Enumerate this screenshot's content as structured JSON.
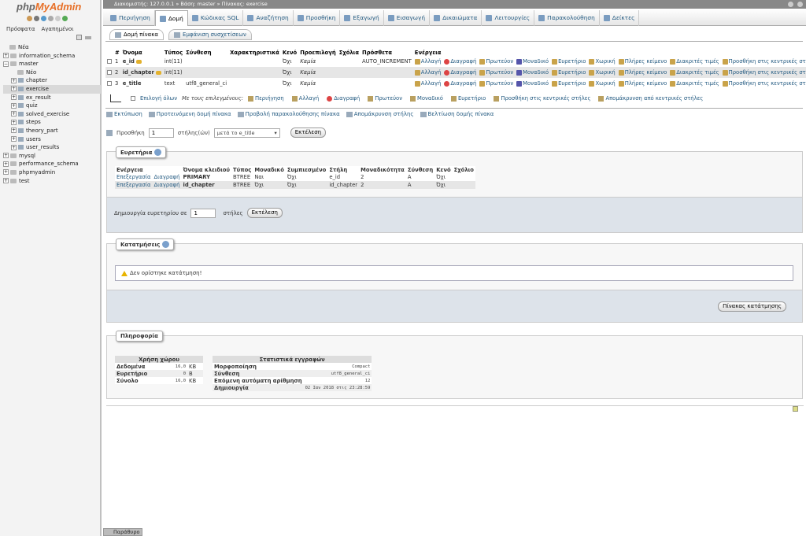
{
  "nav": {
    "logo_part1": "php",
    "logo_part2": "MyAdmin",
    "links": [
      "Πρόσφατα",
      "Αγαπημένοι"
    ],
    "tree": [
      {
        "label": "Νέα",
        "level": 0,
        "kind": "new"
      },
      {
        "label": "information_schema",
        "level": 0,
        "kind": "db"
      },
      {
        "label": "master",
        "level": 0,
        "kind": "db",
        "open": true
      },
      {
        "label": "Νέο",
        "level": 1,
        "kind": "new"
      },
      {
        "label": "chapter",
        "level": 1,
        "kind": "table"
      },
      {
        "label": "exercise",
        "level": 1,
        "kind": "table",
        "selected": true
      },
      {
        "label": "ex_result",
        "level": 1,
        "kind": "table"
      },
      {
        "label": "quiz",
        "level": 1,
        "kind": "table"
      },
      {
        "label": "solved_exercise",
        "level": 1,
        "kind": "table"
      },
      {
        "label": "steps",
        "level": 1,
        "kind": "table"
      },
      {
        "label": "theory_part",
        "level": 1,
        "kind": "table"
      },
      {
        "label": "users",
        "level": 1,
        "kind": "table"
      },
      {
        "label": "user_results",
        "level": 1,
        "kind": "table"
      },
      {
        "label": "mysql",
        "level": 0,
        "kind": "db"
      },
      {
        "label": "performance_schema",
        "level": 0,
        "kind": "db"
      },
      {
        "label": "phpmyadmin",
        "level": 0,
        "kind": "db"
      },
      {
        "label": "test",
        "level": 0,
        "kind": "db"
      }
    ]
  },
  "breadcrumb": "Διακομιστής: 127.0.0.1 » Βάση: master » Πίνακας: exercise",
  "tabs": [
    "Περιήγηση",
    "Δομή",
    "Κώδικας SQL",
    "Αναζήτηση",
    "Προσθήκη",
    "Εξαγωγή",
    "Εισαγωγή",
    "Δικαιώματα",
    "Λειτουργίες",
    "Παρακολούθηση",
    "Δείκτες"
  ],
  "active_tab": 1,
  "subtabs": [
    "Δομή πίνακα",
    "Εμφάνιση συσχετίσεων"
  ],
  "structure": {
    "headers": [
      "#",
      "Όνομα",
      "Τύπος",
      "Σύνθεση",
      "Χαρακτηριστικά",
      "Κενό",
      "Προεπιλογή",
      "Σχόλια",
      "Πρόσθετα",
      "Ενέργεια"
    ],
    "rows": [
      {
        "num": "1",
        "name": "e_id",
        "key": true,
        "type": "int(11)",
        "collation": "",
        "attr": "",
        "null": "Όχι",
        "default": "Καμία",
        "comment": "",
        "extra": "AUTO_INCREMENT"
      },
      {
        "num": "2",
        "name": "id_chapter",
        "key": true,
        "type": "int(11)",
        "collation": "",
        "attr": "",
        "null": "Όχι",
        "default": "Καμία",
        "comment": "",
        "extra": ""
      },
      {
        "num": "3",
        "name": "e_title",
        "key": false,
        "type": "text",
        "collation": "utf8_general_ci",
        "attr": "",
        "null": "Όχι",
        "default": "Καμία",
        "comment": "",
        "extra": ""
      }
    ],
    "actions": [
      "Αλλαγή",
      "Διαγραφή",
      "Πρωτεύον",
      "Μοναδικό",
      "Ευρετήριο",
      "Χωρική",
      "Πλήρες κείμενο",
      "Διακριτές τιμές",
      "Προσθήκη στις κεντρικές στήλες"
    ]
  },
  "bulk": {
    "check_all": "Επιλογή όλων",
    "with_selected": "Με τους επιλεγμένους:",
    "actions": [
      "Περιήγηση",
      "Αλλαγή",
      "Διαγραφή",
      "Πρωτεύον",
      "Μοναδικό",
      "Ευρετήριο",
      "Προσθήκη στις κεντρικές στήλες",
      "Απομάκρυνση από κεντρικές στήλες"
    ]
  },
  "links": [
    "Εκτύπωση",
    "Προτεινόμενη δομή πίνακα",
    "Προβολή παρακολούθησης πίνακα",
    "Απομάκρυνση στήλης",
    "Βελτίωση δομής πίνακα"
  ],
  "add": {
    "label": "Προσθήκη",
    "count": "1",
    "cols_label": "στήλης(ών)",
    "position": "μετά το e_title",
    "go": "Εκτέλεση"
  },
  "indexes": {
    "legend": "Ευρετήρια",
    "headers": [
      "Ενέργεια",
      "",
      "Όνομα κλειδιού",
      "Τύπος",
      "Μοναδικό",
      "Συμπιεσμένο",
      "Στήλη",
      "Μοναδικότητα",
      "Σύνθεση",
      "Κενό",
      "Σχόλιο"
    ],
    "rows": [
      {
        "edit": "Επεξεργασία",
        "drop": "Διαγραφή",
        "name": "PRIMARY",
        "type": "BTREE",
        "unique": "Ναι",
        "packed": "Όχι",
        "column": "e_id",
        "card": "2",
        "coll": "A",
        "null": "Όχι",
        "comment": ""
      },
      {
        "edit": "Επεξεργασία",
        "drop": "Διαγραφή",
        "name": "id_chapter",
        "type": "BTREE",
        "unique": "Όχι",
        "packed": "Όχι",
        "column": "id_chapter",
        "card": "2",
        "coll": "A",
        "null": "Όχι",
        "comment": ""
      }
    ],
    "create_label": "Δημιουργία ευρετηρίου σε",
    "create_count": "1",
    "create_cols": "στήλες",
    "go": "Εκτέλεση"
  },
  "partitions": {
    "legend": "Κατατμήσεις",
    "message": "Δεν ορίστηκε κατάτμηση!",
    "button": "Πίνακας κατάτμησης"
  },
  "info": {
    "legend": "Πληροφορία",
    "space_title": "Χρήση χώρου",
    "space": [
      {
        "label": "Δεδομένα",
        "value": "16,0",
        "unit": "KB"
      },
      {
        "label": "Ευρετήριο",
        "value": "0",
        "unit": "B"
      },
      {
        "label": "Σύνολο",
        "value": "16,0",
        "unit": "KB"
      }
    ],
    "stats_title": "Στατιστικά εγγραφών",
    "stats": [
      {
        "label": "Μορφοποίηση",
        "value": "Compact"
      },
      {
        "label": "Σύνθεση",
        "value": "utf8_general_ci"
      },
      {
        "label": "Επόμενη αυτόματη αρίθμηση",
        "value": "12"
      },
      {
        "label": "Δημιουργία",
        "value": "02 Ιαν 2018 στις 23:28:59"
      }
    ]
  },
  "console": "Παράθυρο",
  "colors": {
    "accent": "#235a81",
    "logo_orange": "#e76f26"
  }
}
